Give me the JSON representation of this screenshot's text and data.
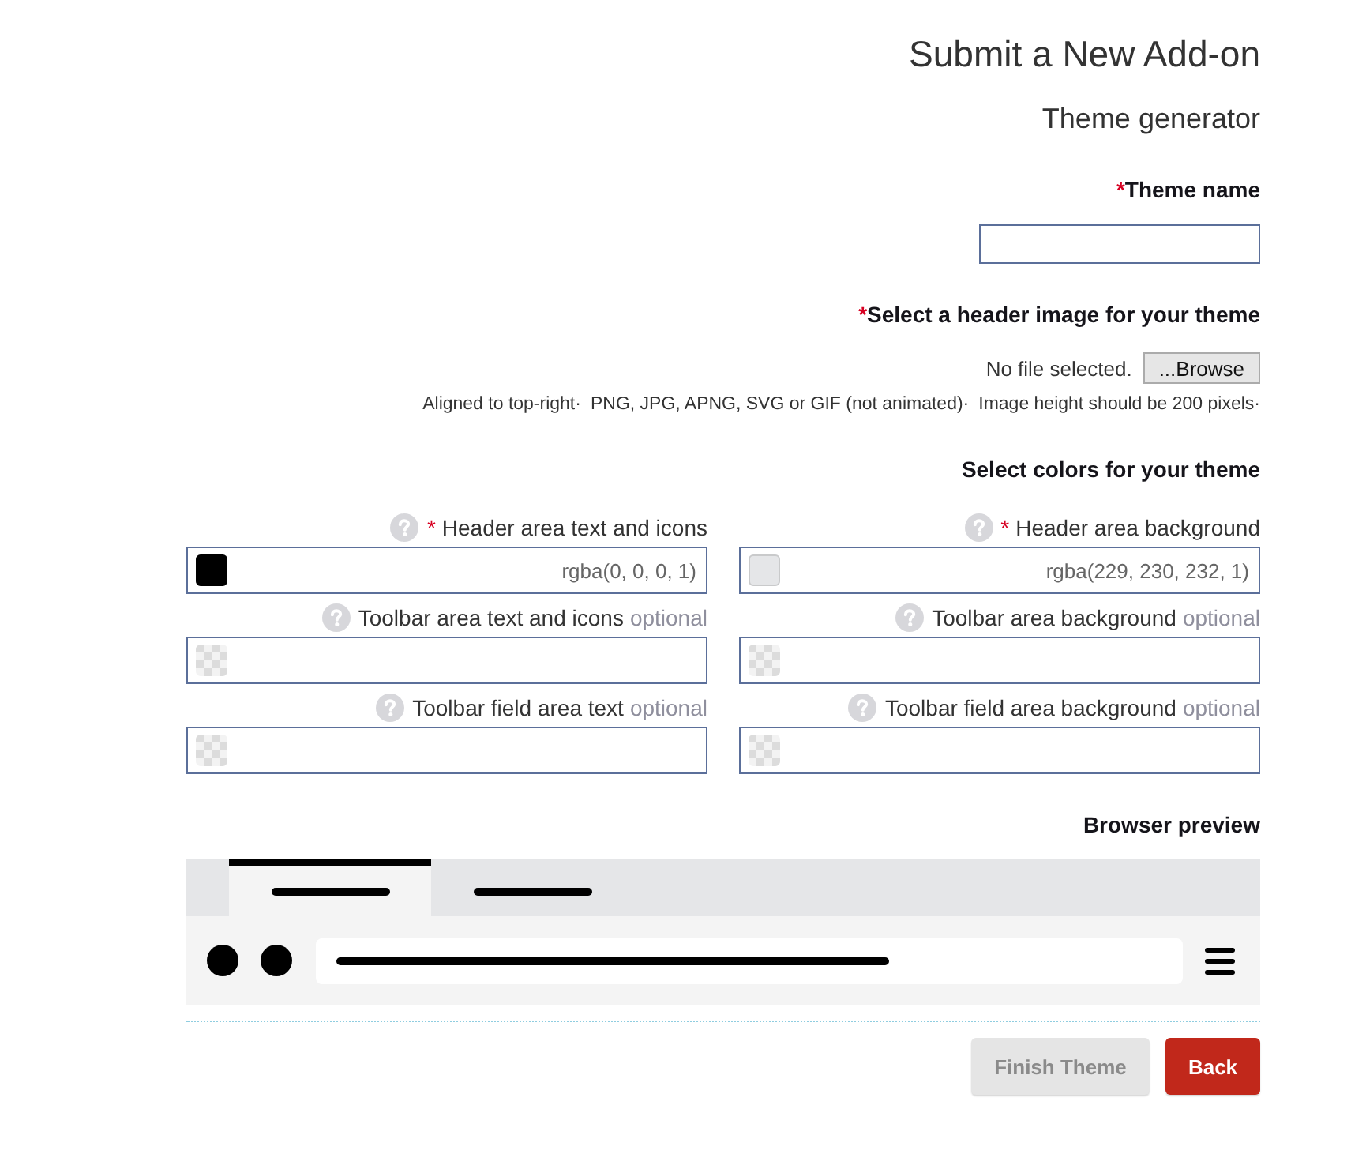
{
  "header": {
    "title": "Submit a New Add-on",
    "subtitle": "Theme generator"
  },
  "theme_name": {
    "required_mark": "*",
    "label": "Theme name"
  },
  "header_image": {
    "required_mark": "*",
    "label": "Select a header image for your theme",
    "file_status": "No file selected.",
    "browse_button": "...Browse",
    "hints": [
      "Aligned to top-right·",
      "PNG, JPG, APNG, SVG or GIF (not animated)·",
      "Image height should be 200 pixels·"
    ]
  },
  "colors": {
    "heading": "Select colors for your theme",
    "fields": [
      {
        "label": "Header area text and icons",
        "required_mark": "*",
        "value": "rgba(0, 0, 0, 1)",
        "color": "#000000"
      },
      {
        "label": "Header area background",
        "required_mark": "*",
        "value": "rgba(229, 230, 232, 1)",
        "color": "#e5e6e8"
      },
      {
        "label": "Toolbar area text and icons",
        "optional_text": "optional"
      },
      {
        "label": "Toolbar area background",
        "optional_text": "optional"
      },
      {
        "label": "Toolbar field area text",
        "optional_text": "optional"
      },
      {
        "label": "Toolbar field area background",
        "optional_text": "optional"
      }
    ]
  },
  "preview": {
    "heading": "Browser preview",
    "tabs": [
      {
        "selected": true
      },
      {
        "selected": false
      }
    ]
  },
  "buttons": [
    {
      "label": "Finish Theme",
      "kind": "primary",
      "disabled": true
    },
    {
      "label": "Back",
      "kind": "danger",
      "disabled": false
    }
  ]
}
